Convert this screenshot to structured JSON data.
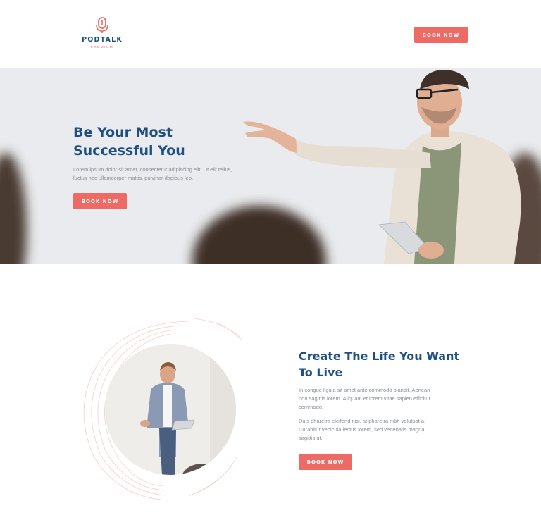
{
  "brand": {
    "name": "PODTALK",
    "tagline": "PREMIUM",
    "accent_color": "#ee6a65",
    "primary_color": "#1d4f83",
    "logo_icon": "microphone-icon"
  },
  "header": {
    "cta_label": "BOOK NOW"
  },
  "hero": {
    "title": "Be Your Most Successful You",
    "text": "Lorem ipsum dolor sit amet, consectetur adipiscing elit. Ut elit tellus, luctus nec ullamcorper mattis, pulvinar dapibus leo.",
    "cta_label": "BOOK NOW"
  },
  "section": {
    "title": "Create The Life You Want To Live",
    "paragraph_1": "In congue ligula sit amet ante commodo blandit. Aenean non sagittis lorem. Aliquam et lorem vitae sapien efficitur commodo.",
    "paragraph_2": "Duis pharetra eleifend nisi, at pharetra nibh volutpat a. Curabitur vehicula lectus lorem, sed venenatis magna sagittis ut.",
    "cta_label": "BOOK NOW"
  }
}
